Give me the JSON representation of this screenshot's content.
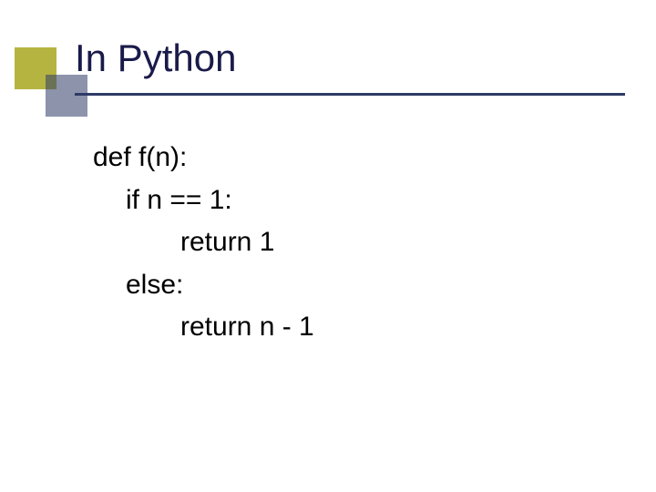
{
  "title": "In Python",
  "code": {
    "l1": "def f(n):",
    "l2": "if n == 1:",
    "l3": "return 1",
    "l4": "else:",
    "l5": "return n - 1"
  },
  "colors": {
    "accent_olive": "#b6b441",
    "accent_navy": "#2e3a66",
    "title_color": "#1a1a4a"
  }
}
